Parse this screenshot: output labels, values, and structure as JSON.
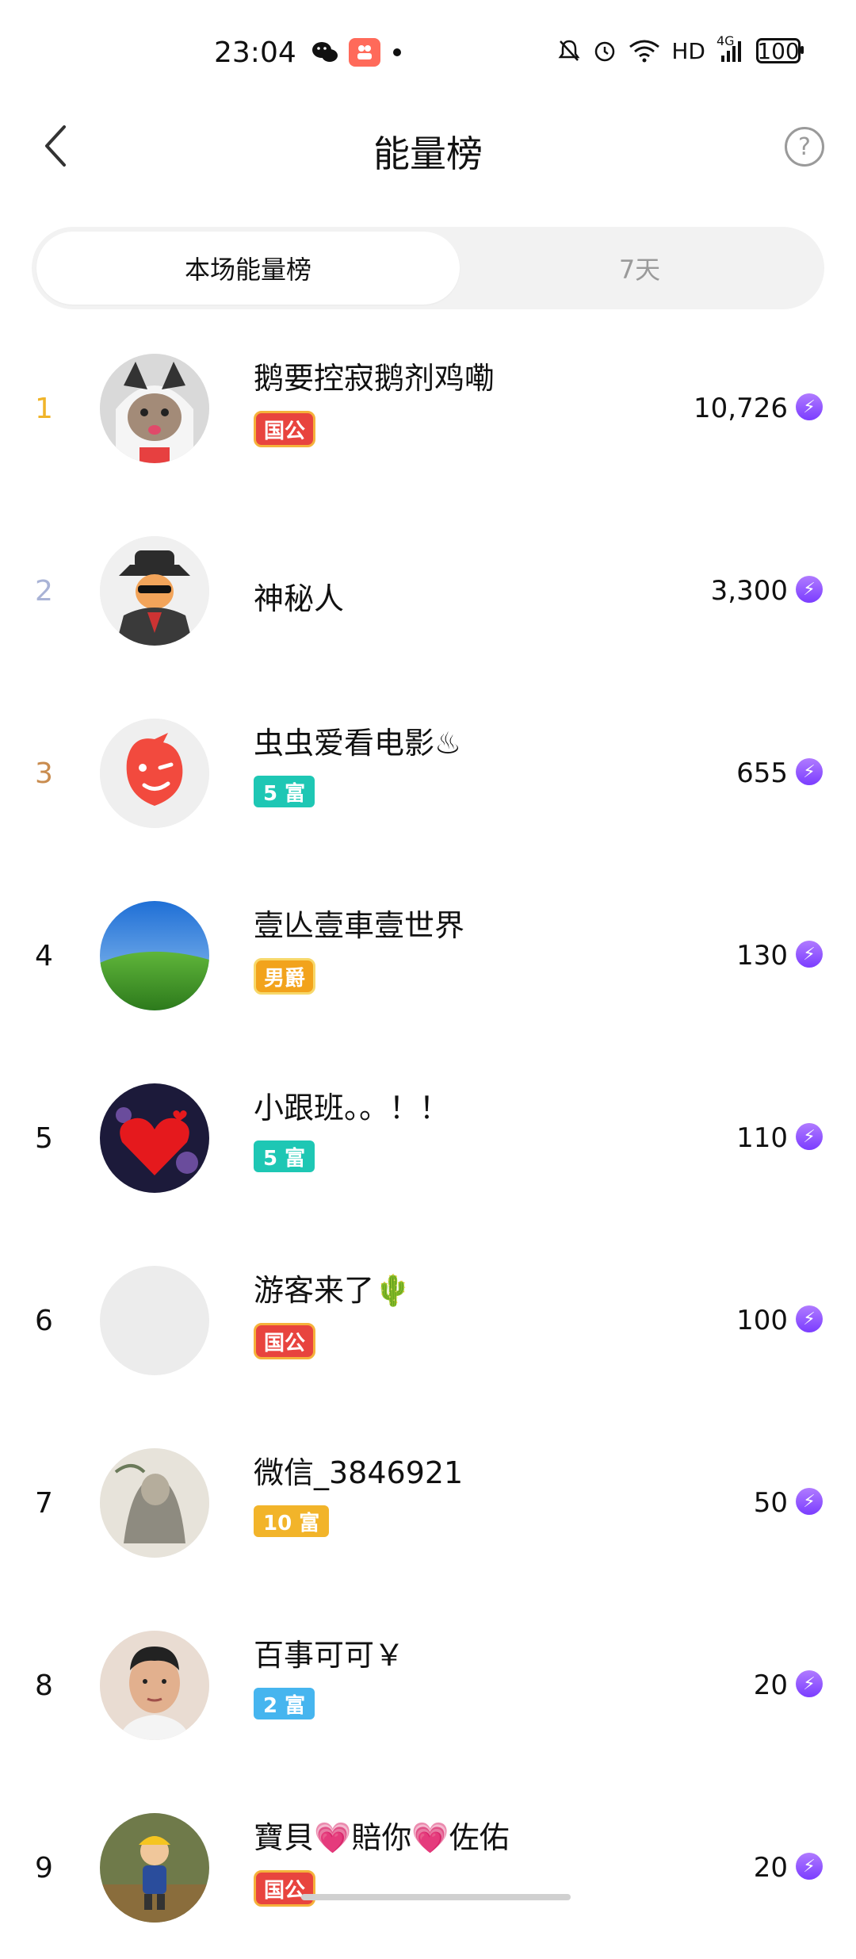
{
  "status_bar": {
    "time": "23:04",
    "network": "HD",
    "signal": "4G",
    "battery": "100"
  },
  "header": {
    "title": "能量榜",
    "help_symbol": "?"
  },
  "tabs": [
    {
      "label": "本场能量榜",
      "active": true
    },
    {
      "label": "7天",
      "active": false
    }
  ],
  "rows": [
    {
      "rank": "1",
      "rank_color": "#f0b429",
      "name": "鹅要控寂鹅剂鸡嘞",
      "badge": "国公",
      "badge_type": "gov",
      "score": "10,726"
    },
    {
      "rank": "2",
      "rank_color": "#a9b3d6",
      "name": "神秘人",
      "badge": "",
      "badge_type": "",
      "score": "3,300"
    },
    {
      "rank": "3",
      "rank_color": "#c98c4f",
      "name": "虫虫爱看电影♨",
      "badge": "5 富",
      "badge_type": "rich5",
      "score": "655"
    },
    {
      "rank": "4",
      "rank_color": "#111111",
      "name": "壹亾壹車壹世界",
      "badge": "男爵",
      "badge_type": "duke",
      "score": "130"
    },
    {
      "rank": "5",
      "rank_color": "#111111",
      "name": "小跟班。。！！",
      "badge": "5 富",
      "badge_type": "rich5",
      "score": "110"
    },
    {
      "rank": "6",
      "rank_color": "#111111",
      "name": "游客来了🌵",
      "badge": "国公",
      "badge_type": "gov",
      "score": "100"
    },
    {
      "rank": "7",
      "rank_color": "#111111",
      "name": "微信_3846921",
      "badge": "10 富",
      "badge_type": "rich10",
      "score": "50"
    },
    {
      "rank": "8",
      "rank_color": "#111111",
      "name": "百事可可￥",
      "badge": "2 富",
      "badge_type": "rich2",
      "score": "20"
    },
    {
      "rank": "9",
      "rank_color": "#111111",
      "name": "寶貝💗賠你💗佐佑",
      "badge": "国公",
      "badge_type": "gov",
      "score": "20"
    }
  ],
  "icons": {
    "energy": "energy-bolt-icon"
  }
}
